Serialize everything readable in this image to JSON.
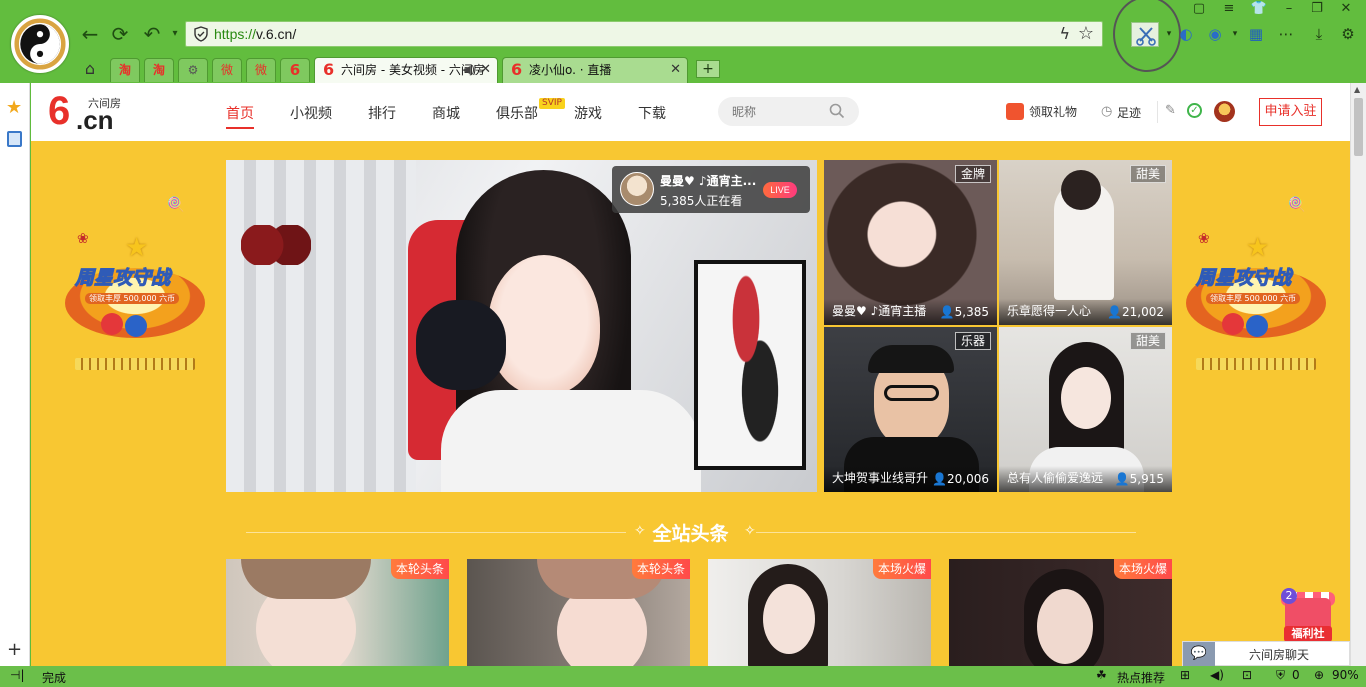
{
  "browser": {
    "url_scheme": "https://",
    "url_host": "v.6.cn/",
    "tabs": [
      {
        "label": "六间房 - 美女视频 - 六间房",
        "active": true
      },
      {
        "label": "凌小仙o. · 直播",
        "active": false
      }
    ],
    "mini_tabs": [
      "淘",
      "淘",
      "⚙",
      "微",
      "微",
      "6"
    ],
    "new_tab_label": "+"
  },
  "site": {
    "logo_six": "6",
    "logo_cn": ".cn",
    "logo_name": "六间房",
    "nav": [
      {
        "label": "首页",
        "active": true
      },
      {
        "label": "小视频"
      },
      {
        "label": "排行"
      },
      {
        "label": "商城"
      },
      {
        "label": "俱乐部"
      },
      {
        "label": "游戏"
      },
      {
        "label": "下载"
      }
    ],
    "svip_badge": "SVIP",
    "search_placeholder": "昵称",
    "gift_label": "领取礼物",
    "footprint_label": "足迹",
    "apply_label": "申请入驻"
  },
  "banner": {
    "title": "周星攻守战",
    "subtitle": "领取丰厚 500,000 六币"
  },
  "main_stream": {
    "name": "曼曼♥ ♪通宵主...",
    "viewers": "5,385人正在看",
    "badge": "LIVE"
  },
  "thumbs": [
    {
      "tag": "金牌",
      "name": "曼曼♥ ♪通宵主播",
      "count": "5,385"
    },
    {
      "tag": "甜美",
      "name": "乐章愿得一人心",
      "count": "21,002"
    },
    {
      "tag": "乐器",
      "name": "大坤贺事业线哥升",
      "count": "20,006"
    },
    {
      "tag": "甜美",
      "name": "总有人偷偷爱逸远",
      "count": "5,915"
    }
  ],
  "section_title": "全站头条",
  "cards": [
    {
      "tag": "本轮头条"
    },
    {
      "tag": "本轮头条"
    },
    {
      "tag": "本场火爆"
    },
    {
      "tag": "本场火爆"
    }
  ],
  "welfare": {
    "count": "2",
    "label": "福利社"
  },
  "chat_label": "六间房聊天",
  "status": {
    "done": "完成",
    "hot": "热点推荐",
    "counter": "0",
    "zoom": "90%"
  },
  "colors": {
    "brand_red": "#e8302a",
    "page_yellow": "#f8c732",
    "chrome_green": "#62bd3e"
  }
}
